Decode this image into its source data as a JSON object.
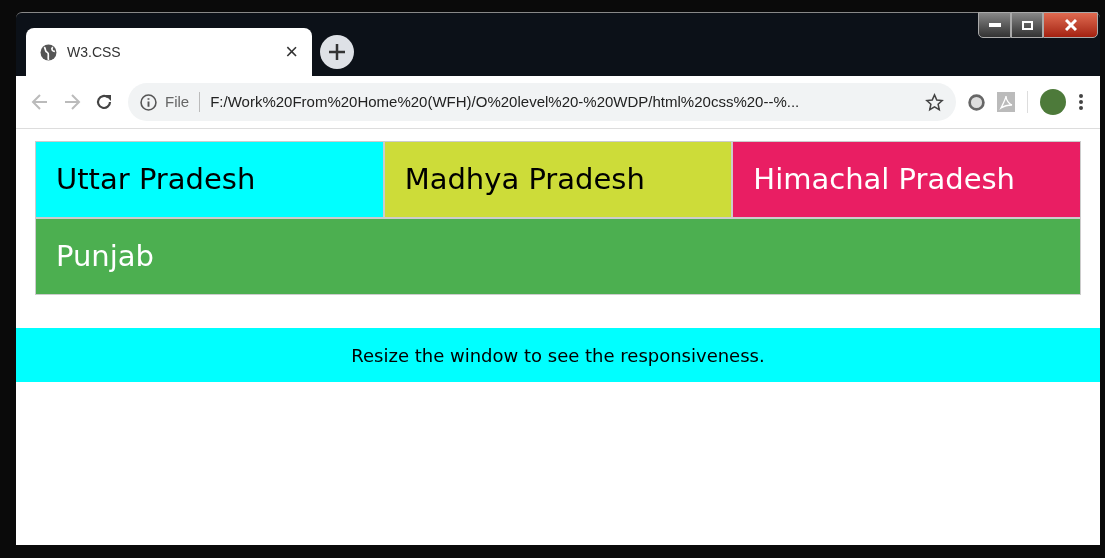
{
  "tab": {
    "title": "W3.CSS",
    "close": "×"
  },
  "address_bar": {
    "scheme_label": "File",
    "url": "F:/Work%20From%20Home%20(WFH)/O%20level%20-%20WDP/html%20css%20--%..."
  },
  "panels": [
    {
      "label": "Uttar Pradesh",
      "color": "#00ffff",
      "kind": "third"
    },
    {
      "label": "Madhya Pradesh",
      "color": "#cddc39",
      "kind": "third"
    },
    {
      "label": "Himachal Pradesh",
      "color": "#e91e63",
      "kind": "third"
    },
    {
      "label": "Punjab",
      "color": "#4caf50",
      "kind": "full"
    }
  ],
  "footer": {
    "text": "Resize the window to see the responsiveness."
  }
}
